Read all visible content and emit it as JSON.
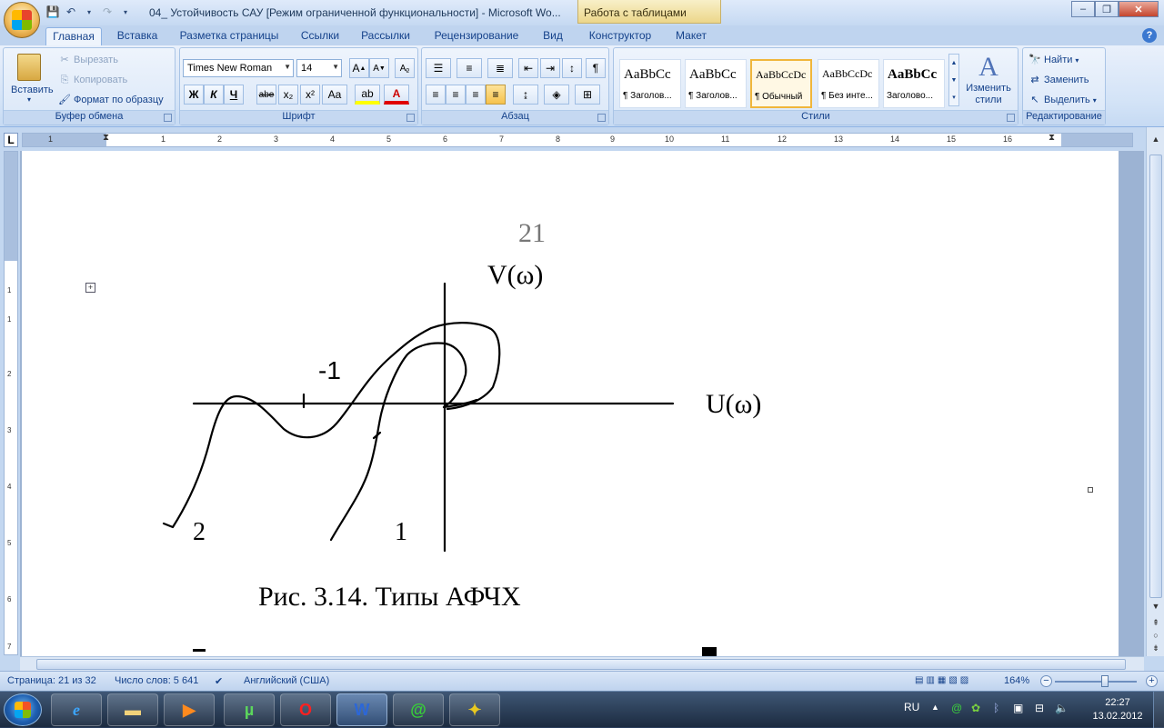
{
  "window": {
    "title": "04_ Устойчивость САУ [Режим ограниченной функциональности] - Microsoft Wo...",
    "context_tab": "Работа с таблицами",
    "buttons": {
      "min": "–",
      "max": "❐",
      "close": "✕"
    }
  },
  "ribbon_tabs": [
    "Главная",
    "Вставка",
    "Разметка страницы",
    "Ссылки",
    "Рассылки",
    "Рецензирование",
    "Вид",
    "Конструктор",
    "Макет"
  ],
  "clipboard": {
    "paste": "Вставить",
    "cut": "Вырезать",
    "copy": "Копировать",
    "format_painter": "Формат по образцу",
    "label": "Буфер обмена"
  },
  "font": {
    "family": "Times New Roman",
    "size": "14",
    "label": "Шрифт",
    "bold": "Ж",
    "italic": "К",
    "underline": "Ч",
    "strike": "abe",
    "sub": "x₂",
    "sup": "x²",
    "case": "Aa"
  },
  "paragraph": {
    "label": "Абзац"
  },
  "styles": {
    "label": "Стили",
    "items": [
      {
        "sample": "AaBbCc",
        "name": "¶ Заголов..."
      },
      {
        "sample": "AaBbCc",
        "name": "¶ Заголов..."
      },
      {
        "sample": "AaBbCcDc",
        "name": "¶ Обычный"
      },
      {
        "sample": "AaBbCcDc",
        "name": "¶ Без инте..."
      },
      {
        "sample": "AaBbCc",
        "name": "Заголово..."
      }
    ],
    "change": "Изменить стили"
  },
  "editing": {
    "label": "Редактирование",
    "find": "Найти",
    "replace": "Заменить",
    "select": "Выделить"
  },
  "ruler": {
    "numbers": [
      "1",
      "1",
      "2",
      "3",
      "4",
      "5",
      "6",
      "7",
      "8",
      "9",
      "10",
      "11",
      "12",
      "13",
      "14",
      "15",
      "16"
    ],
    "vnumbers": [
      "1",
      "1",
      "2",
      "3",
      "4",
      "5",
      "6",
      "7"
    ]
  },
  "document": {
    "page_number": "21",
    "axis_v": "V(ω)",
    "axis_u": "U(ω)",
    "minus_one": "-1",
    "curve_2": "2",
    "curve_1": "1",
    "caption": "Рис. 3.14. Типы АФЧХ"
  },
  "status": {
    "page": "Страница: 21 из 32",
    "words": "Число слов: 5 641",
    "language": "Английский (США)",
    "zoom": "164%"
  },
  "taskbar": {
    "lang": "RU",
    "time": "22:27",
    "date": "13.02.2012"
  }
}
